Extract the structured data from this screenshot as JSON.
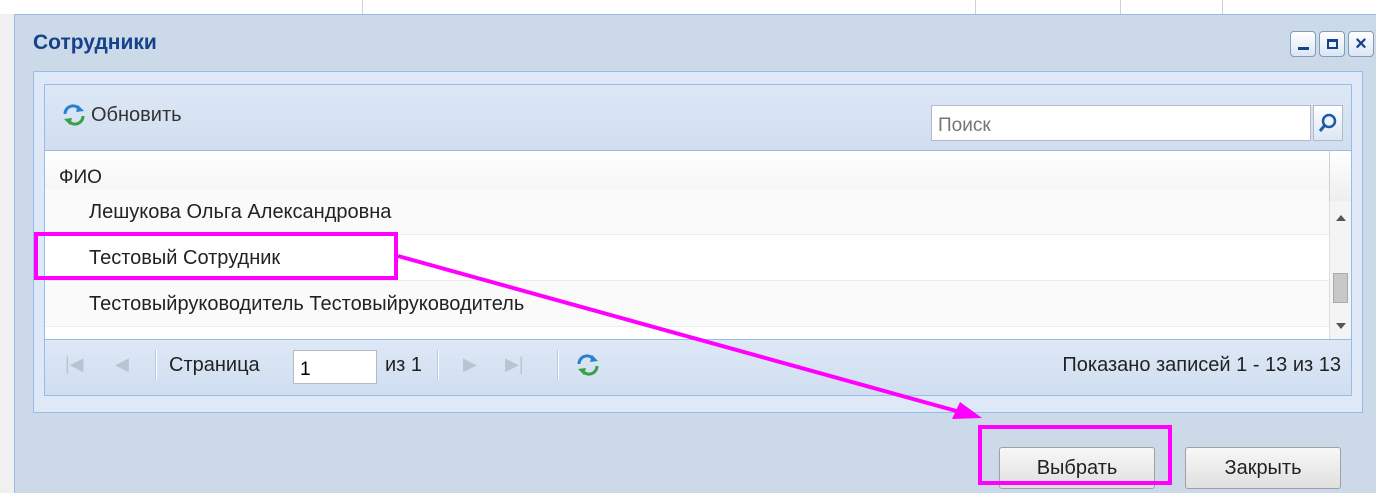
{
  "window": {
    "title": "Сотрудники",
    "tools": [
      "minimize-icon",
      "maximize-icon",
      "close-icon"
    ]
  },
  "toolbar": {
    "refresh_label": "Обновить",
    "search_placeholder": "Поиск",
    "search_value": ""
  },
  "grid": {
    "column_header": "ФИО",
    "rows": [
      "Лешукова Ольга Александровна",
      "Тестовый Сотрудник",
      "Тестовыйруководитель Тестовыйруководитель"
    ]
  },
  "pager": {
    "page_label": "Страница",
    "page_value": "1",
    "of_label": "из 1",
    "info": "Показано записей 1 - 13 из 13"
  },
  "buttons": {
    "select_label": "Выбрать",
    "close_label": "Закрыть"
  },
  "colors": {
    "highlight": "#ff00ff",
    "title": "#15428b",
    "window_bg": "#ccd9e8"
  }
}
